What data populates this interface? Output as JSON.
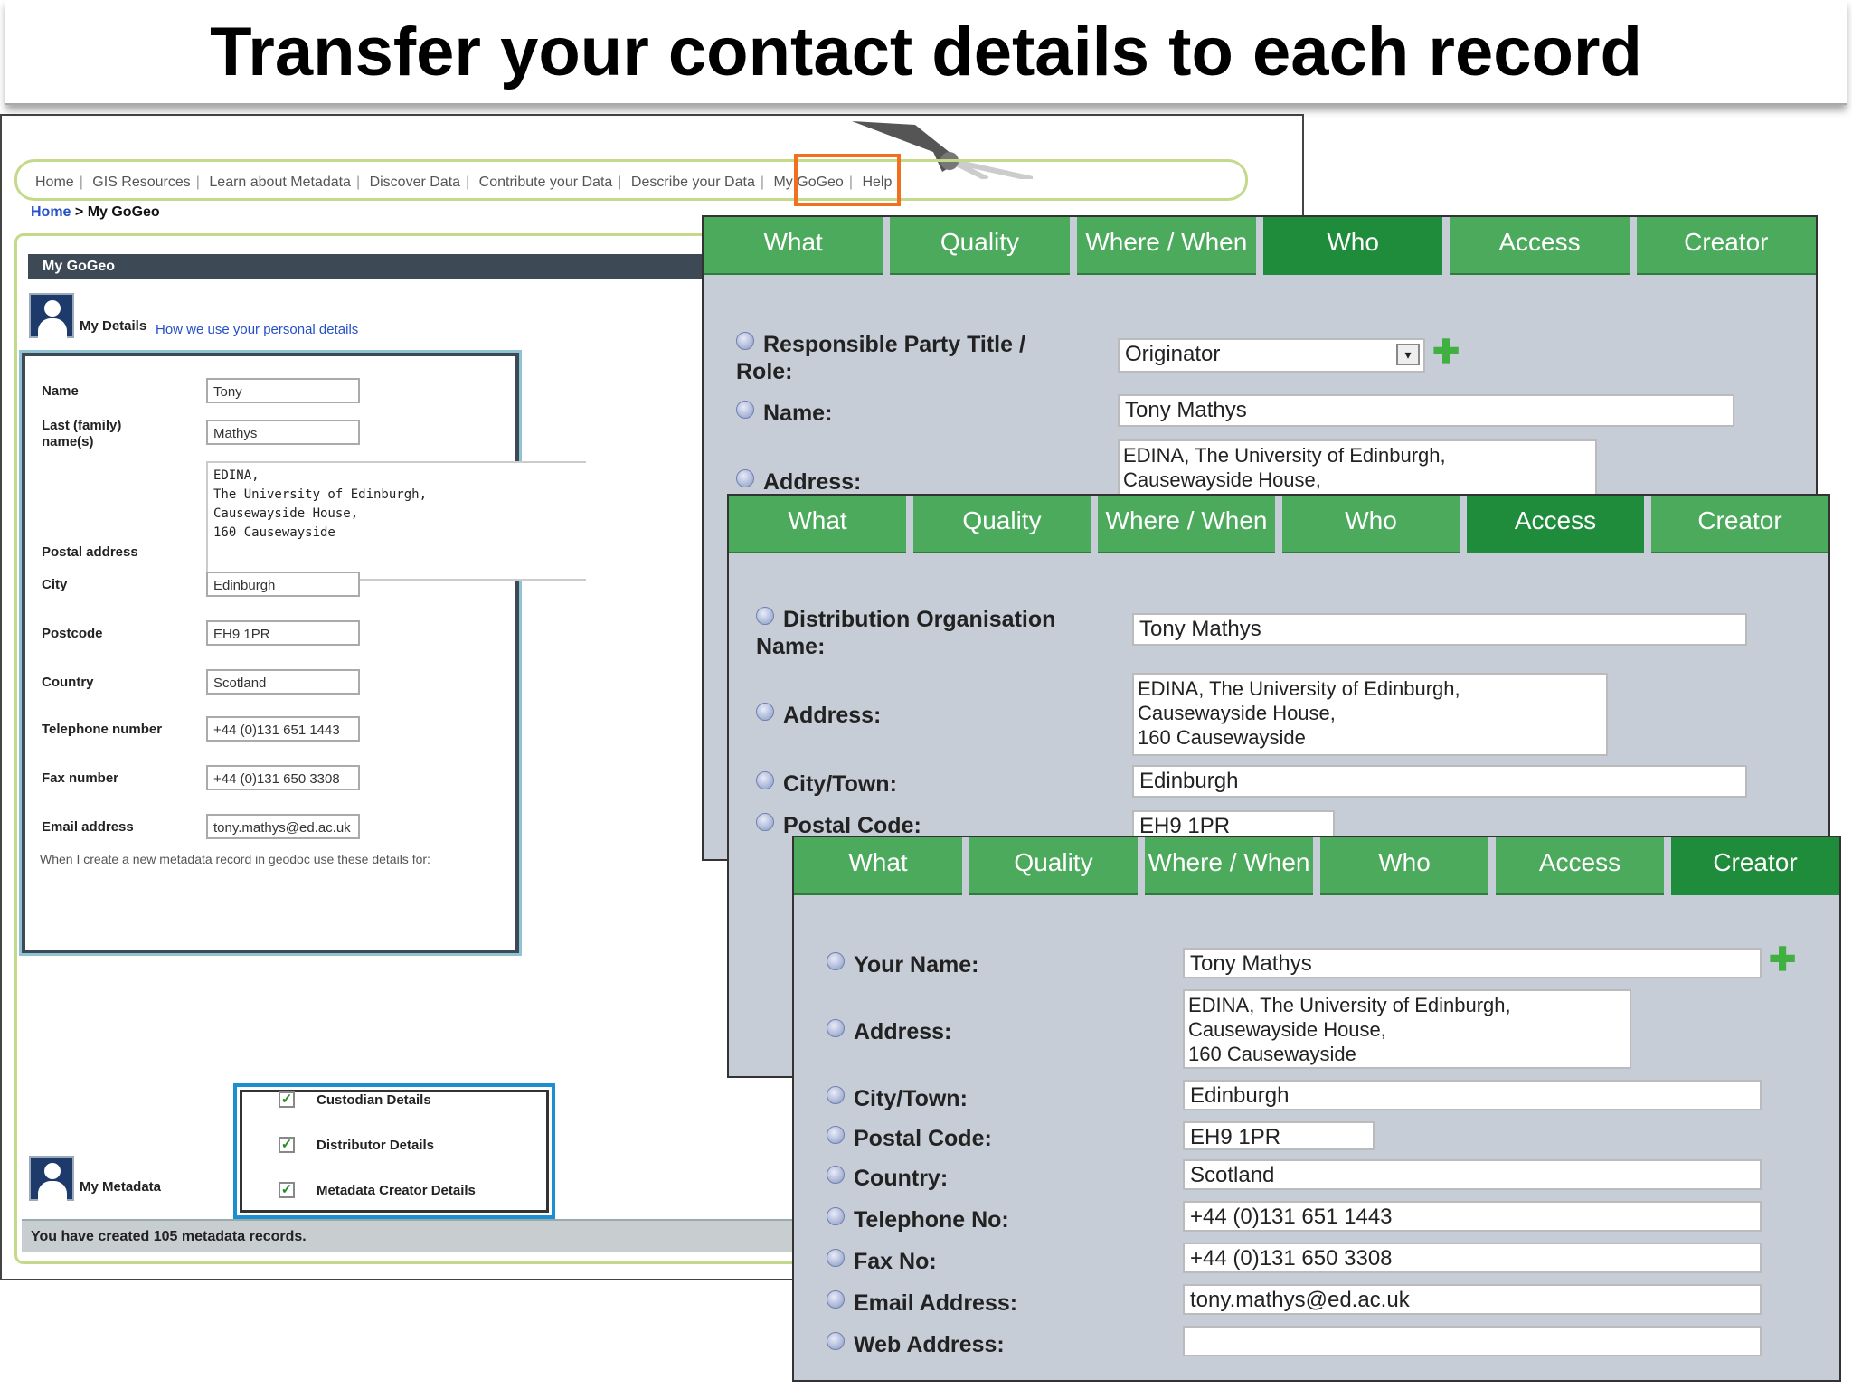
{
  "slide": {
    "title": "Transfer your contact details to each record"
  },
  "gogeo": {
    "nav": [
      "Home",
      "GIS Resources",
      "Learn about Metadata",
      "Discover Data",
      "Contribute your Data",
      "Describe your Data",
      "My GoGeo",
      "Help"
    ],
    "breadcrumb": {
      "home": "Home",
      "sep": " > ",
      "current": "My GoGeo"
    },
    "panel_title": "My GoGeo",
    "my_details_label": "My Details",
    "privacy_link": "How we use your personal details",
    "fields": {
      "name_label": "Name",
      "name": "Tony",
      "last_label": "Last (family) name(s)",
      "last": "Mathys",
      "postal_label": "Postal address",
      "postal": "EDINA,\nThe University of Edinburgh,\nCausewayside House,\n160 Causewayside",
      "city_label": "City",
      "city": "Edinburgh",
      "postcode_label": "Postcode",
      "postcode": "EH9 1PR",
      "country_label": "Country",
      "country": "Scotland",
      "tel_label": "Telephone number",
      "tel": "+44 (0)131 651 1443",
      "fax_label": "Fax number",
      "fax": "+44 (0)131 650 3308",
      "email_label": "Email address",
      "email": "tony.mathys@ed.ac.uk"
    },
    "note": "When I create a new metadata record in geodoc use these details for:",
    "checkboxes": [
      "Custodian Details",
      "Distributor Details",
      "Metadata Creator Details"
    ],
    "my_metadata_label": "My Metadata",
    "records_created": "You have created 105 metadata records."
  },
  "tabs": [
    "What",
    "Quality",
    "Where / When",
    "Who",
    "Access",
    "Creator"
  ],
  "check_mark": "✓",
  "plus_symbol": "✚",
  "select_arrow": "▾",
  "who_form": {
    "active_tab": "Who",
    "role_label": "Responsible Party Title / Role:",
    "role_value": "Originator",
    "name_label": "Name:",
    "name_value": "Tony Mathys",
    "address_label": "Address:",
    "address_value": "EDINA, The University of Edinburgh,\nCausewayside House,"
  },
  "access_form": {
    "active_tab": "Access",
    "org_label": "Distribution Organisation Name:",
    "org_value": "Tony Mathys",
    "address_label": "Address:",
    "address_value": "EDINA, The University of Edinburgh,\nCausewayside House,\n160 Causewayside",
    "city_label": "City/Town:",
    "city_value": "Edinburgh",
    "postal_label": "Postal Code:",
    "postal_value": "EH9 1PR"
  },
  "creator_form": {
    "active_tab": "Creator",
    "name_label": "Your Name:",
    "name_value": "Tony Mathys",
    "address_label": "Address:",
    "address_value": "EDINA, The University of Edinburgh,\nCausewayside House,\n160 Causewayside",
    "city_label": "City/Town:",
    "city_value": "Edinburgh",
    "postal_label": "Postal Code:",
    "postal_value": "EH9 1PR",
    "country_label": "Country:",
    "country_value": "Scotland",
    "tel_label": "Telephone No:",
    "tel_value": "+44 (0)131 651 1443",
    "fax_label": "Fax No:",
    "fax_value": "+44 (0)131 650 3308",
    "email_label": "Email Address:",
    "email_value": "tony.mathys@ed.ac.uk",
    "web_label": "Web Address:",
    "web_value": ""
  },
  "colors": {
    "tab_green": "#4caa5c",
    "tab_active": "#1e8c3a",
    "highlight_orange": "#f07020",
    "highlight_blue": "#1b8fd0"
  }
}
